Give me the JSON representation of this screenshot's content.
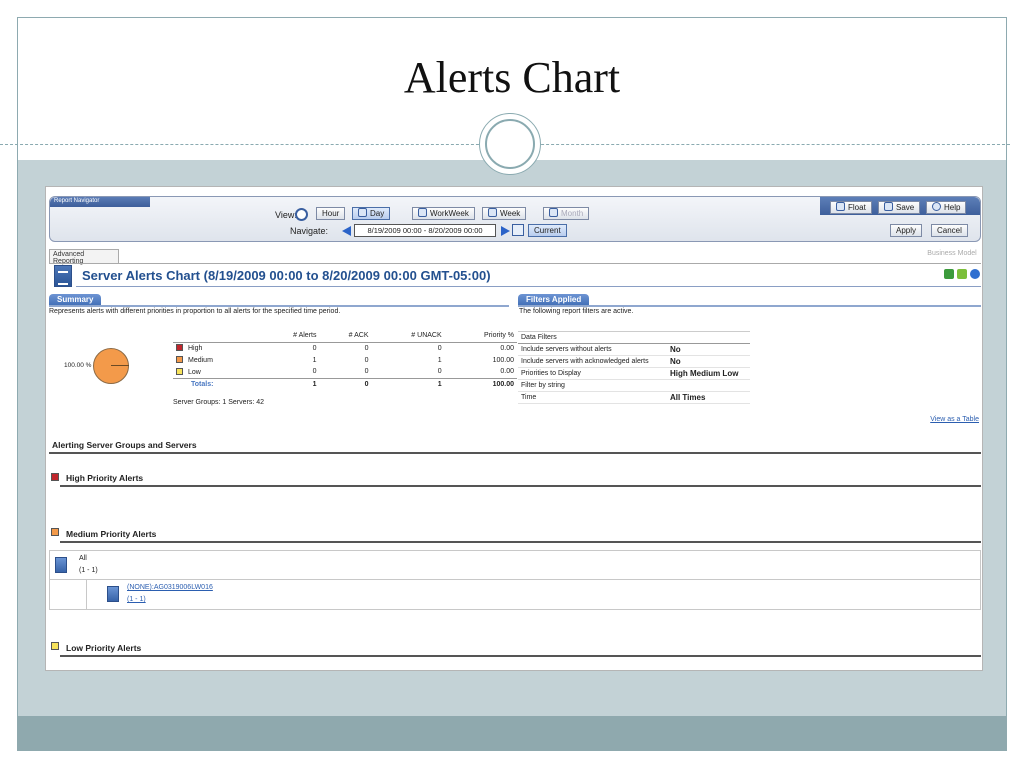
{
  "slide": {
    "title": "Alerts Chart"
  },
  "navigator": {
    "tab_label": "Report Navigator",
    "view_label": "View:",
    "navigate_label": "Navigate:",
    "views": [
      "Hour",
      "Day",
      "WorkWeek",
      "Week",
      "Month"
    ],
    "selected_view": "Day",
    "date_range": "8/19/2009 00:00 - 8/20/2009 00:00",
    "current_label": "Current",
    "float_label": "Float",
    "save_label": "Save",
    "help_label": "Help",
    "apply_label": "Apply",
    "cancel_label": "Cancel"
  },
  "tabs": {
    "advanced": "Advanced Reporting",
    "business": "Business Model"
  },
  "report": {
    "title": "Server Alerts Chart (8/19/2009 00:00 to 8/20/2009 00:00 GMT-05:00)"
  },
  "summary": {
    "section_title": "Summary",
    "description": "Represents alerts with different priorities in proportion to all alerts for the specified time period.",
    "pie_label": "100.00 %",
    "columns": [
      "# Alerts",
      "# ACK",
      "# UNACK",
      "Priority %"
    ],
    "rows": [
      {
        "label": "High",
        "color": "#c0262c",
        "alerts": "0",
        "ack": "0",
        "unack": "0",
        "pct": "0.00"
      },
      {
        "label": "Medium",
        "color": "#f39a4a",
        "alerts": "1",
        "ack": "0",
        "unack": "1",
        "pct": "100.00"
      },
      {
        "label": "Low",
        "color": "#f7e35a",
        "alerts": "0",
        "ack": "0",
        "unack": "0",
        "pct": "0.00"
      }
    ],
    "totals": {
      "label": "Totals:",
      "alerts": "1",
      "ack": "0",
      "unack": "1",
      "pct": "100.00"
    },
    "server_groups": "Server Groups:  1     Servers:  42"
  },
  "filters": {
    "section_title": "Filters Applied",
    "description": "The following report filters are active.",
    "header": "Data Filters",
    "rows": [
      {
        "label": "Include servers without alerts",
        "value": "No"
      },
      {
        "label": "Include servers with acknowledged alerts",
        "value": "No"
      },
      {
        "label": "Priorities to Display",
        "value": "High Medium Low"
      },
      {
        "label": "Filter by string",
        "value": ""
      },
      {
        "label": "Time",
        "value": "All Times"
      }
    ]
  },
  "view_as_table": "View as a Table",
  "alerting": {
    "heading": "Alerting Server Groups and Servers",
    "high_title": "High Priority Alerts",
    "medium_title": "Medium Priority Alerts",
    "low_title": "Low Priority Alerts",
    "group_name": "All",
    "group_range": "(1 - 1)",
    "server_link": "(NONE):AG0319006LW016",
    "server_range": "(1 - 1)"
  },
  "colors": {
    "high": "#c0262c",
    "medium": "#f39a4a",
    "low": "#f7e35a",
    "accent": "#23508f"
  }
}
